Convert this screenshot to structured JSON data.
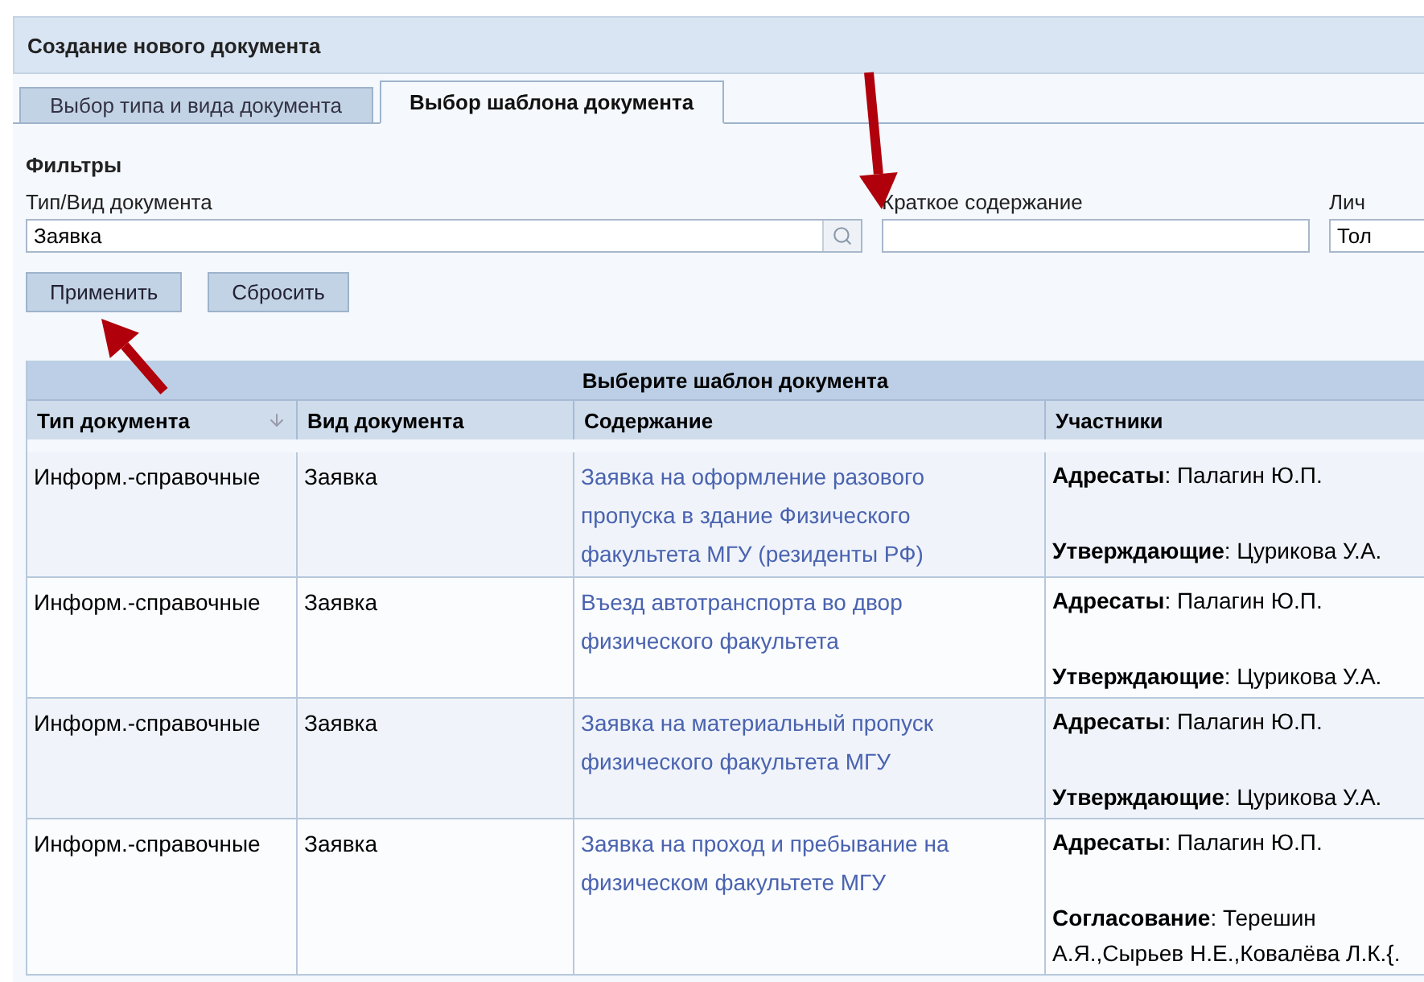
{
  "window": {
    "title": "Создание нового документа"
  },
  "tabs": [
    {
      "label": "Выбор типа и вида документа",
      "selected": false
    },
    {
      "label": "Выбор шаблона документа",
      "selected": true
    }
  ],
  "filters": {
    "title": "Фильтры",
    "fields": [
      {
        "label": "Тип/Вид документа",
        "value": "Заявка",
        "kind": "lookup"
      },
      {
        "label": "Краткое содержание",
        "kind": "text"
      },
      {
        "label": "Лич",
        "value": "Тол",
        "kind": "text"
      }
    ],
    "buttons": [
      "Применить",
      "Сбросить"
    ]
  },
  "table": {
    "caption": "Выберите шаблон документа",
    "columns": [
      {
        "label": "Тип документа",
        "sorted": true
      },
      {
        "label": "Вид документа",
        "sorted": false
      },
      {
        "label": "Содержание",
        "sorted": false
      },
      {
        "label": "Участники",
        "sorted": false
      }
    ],
    "rows": [
      {
        "type": "Информ.-справочные",
        "kind": "Заявка",
        "content": "Заявка на оформление разового пропуска в здание Физического факультета МГУ (резиденты РФ)",
        "participants": [
          "**Адресаты**: Палагин Ю.П.",
          "**Утверждающие**: Цурикова У.А."
        ]
      },
      {
        "type": "Информ.-справочные",
        "kind": "Заявка",
        "content": "Въезд автотранспорта во двор физического факультета",
        "participants": [
          "**Адресаты**: Палагин Ю.П.",
          "**Утверждающие**: Цурикова У.А."
        ]
      },
      {
        "type": "Информ.-справочные",
        "kind": "Заявка",
        "content": "Заявка на материальный пропуск физического факультета МГУ",
        "participants": [
          "**Адресаты**: Палагин Ю.П.",
          "**Утверждающие**: Цурикова У.А."
        ]
      },
      {
        "type": "Информ.-справочные",
        "kind": "Заявка",
        "content": "Заявка на проход и пребывание на физическом факультете МГУ",
        "participants": [
          "**Адресаты**: Палагин Ю.П.",
          "**Согласование**: Терешин А.Я.,Сырьев Н.Е.,Ковалёва Л.К.{."
        ]
      }
    ]
  }
}
